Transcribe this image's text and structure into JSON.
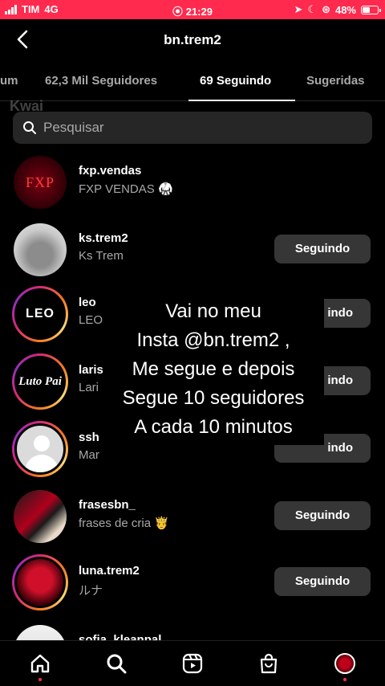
{
  "status": {
    "carrier": "TIM",
    "network": "4G",
    "time": "21:29",
    "battery": "48%"
  },
  "header": {
    "title": "bn.trem2"
  },
  "tabs": [
    {
      "label": "um"
    },
    {
      "label": "62,3 Mil Seguidores"
    },
    {
      "label": "69 Seguindo"
    },
    {
      "label": "Sugeridas"
    }
  ],
  "watermark": {
    "text": "Kwai"
  },
  "search": {
    "placeholder": "Pesquisar"
  },
  "accounts": [
    {
      "username": "fxp.vendas",
      "name": "FXP VENDAS",
      "emoji": "🥋",
      "button": "",
      "avatar_text": "FXP"
    },
    {
      "username": "ks.trem2",
      "name": "Ks Trem",
      "button": "Seguindo"
    },
    {
      "username": "leo",
      "name": "LEO",
      "button": "indo",
      "avatar_text": "LEO"
    },
    {
      "username": "laris",
      "name": "Lari",
      "button": "indo",
      "avatar_text": "Luto Pai"
    },
    {
      "username": "ssh",
      "name": "Mar",
      "button": "indo"
    },
    {
      "username": "frasesbn_",
      "name": "frases de cria",
      "emoji": "🤴",
      "button": "Seguindo"
    },
    {
      "username": "luna.trem2",
      "name": "ルナ",
      "button": "Seguindo"
    },
    {
      "username": "sofia_kleanpal",
      "name": "",
      "button": ""
    }
  ],
  "overlay": {
    "lines": [
      "Vai no meu",
      "Insta @bn.trem2 ,",
      "Me segue e depois",
      "Segue 10 seguidores",
      "A cada 10 minutos"
    ]
  },
  "colors": {
    "status_bar": "#ff2a4d",
    "button_bg": "#363636",
    "notification_dot": "#ff3040"
  }
}
